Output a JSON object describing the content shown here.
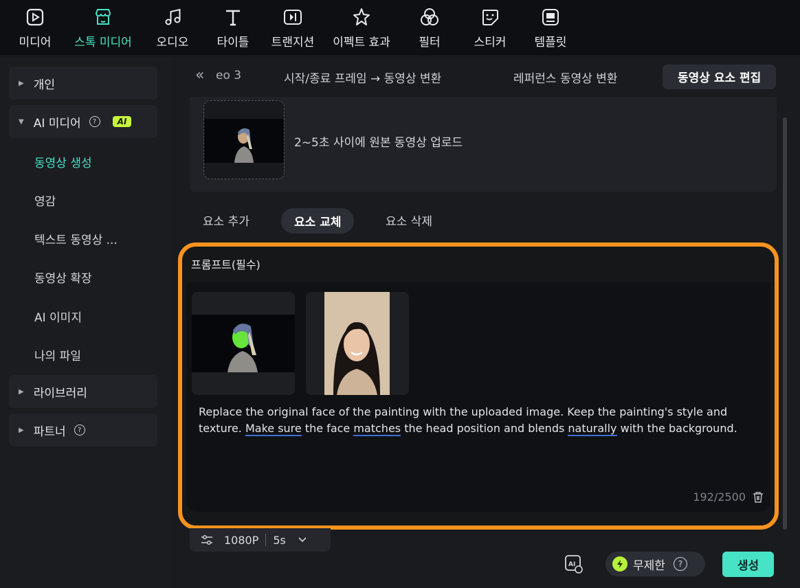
{
  "toolbar": {
    "items": [
      {
        "label": "미디어",
        "icon": "media-icon",
        "active": false
      },
      {
        "label": "스톡 미디어",
        "icon": "store-icon",
        "active": true
      },
      {
        "label": "오디오",
        "icon": "music-note-icon",
        "active": false
      },
      {
        "label": "타이틀",
        "icon": "title-t-icon",
        "active": false
      },
      {
        "label": "트랜지션",
        "icon": "transition-icon",
        "active": false
      },
      {
        "label": "이펙트 효과",
        "icon": "effects-icon",
        "active": false
      },
      {
        "label": "필터",
        "icon": "filter-icon",
        "active": false
      },
      {
        "label": "스티커",
        "icon": "sticker-icon",
        "active": false
      },
      {
        "label": "템플릿",
        "icon": "template-icon",
        "active": false
      }
    ],
    "accent": "#49e2c4"
  },
  "sidebar": {
    "groups": [
      {
        "label": "개인",
        "expanded": false
      },
      {
        "label": "AI 미디어",
        "expanded": true,
        "badge": "AI"
      },
      {
        "label": "라이브러리",
        "expanded": false
      },
      {
        "label": "파트너",
        "expanded": false
      }
    ],
    "subitems": [
      {
        "label": "동영상 생성",
        "active": true
      },
      {
        "label": "영감",
        "active": false
      },
      {
        "label": "텍스트 동영상 ...",
        "active": false
      },
      {
        "label": "동영상 확장",
        "active": false
      },
      {
        "label": "AI 이미지",
        "active": false
      },
      {
        "label": "나의 파일",
        "active": false
      }
    ]
  },
  "tabs": {
    "collapse_icon": "«",
    "partial": "eo 3",
    "items": [
      "시작/종료 프레임 → 동영상 변환",
      "레퍼런스 동영상 변환",
      "동영상 요소 편집"
    ],
    "active_index": 2
  },
  "upload": {
    "text": "2~5초 사이에 원본 동영상 업로드"
  },
  "subtabs": {
    "items": [
      "요소 추가",
      "요소 교체",
      "요소 삭제"
    ],
    "active_index": 1
  },
  "prompt": {
    "title": "프롬프트(필수)",
    "text_parts": [
      {
        "t": "Replace the original face of the painting with the uploaded image. Keep the painting's style and texture. ",
        "u": false
      },
      {
        "t": "Make sure",
        "u": true
      },
      {
        "t": " the face ",
        "u": false
      },
      {
        "t": "matches",
        "u": true
      },
      {
        "t": " the head position and blends ",
        "u": false
      },
      {
        "t": "naturally",
        "u": true
      },
      {
        "t": " with the background.",
        "u": false
      }
    ],
    "char_count": "192/2500",
    "highlight_color": "#f7931e"
  },
  "settings": {
    "resolution": "1080P",
    "duration": "5s"
  },
  "actions": {
    "unlimited_label": "무제한",
    "generate_label": "생성"
  }
}
